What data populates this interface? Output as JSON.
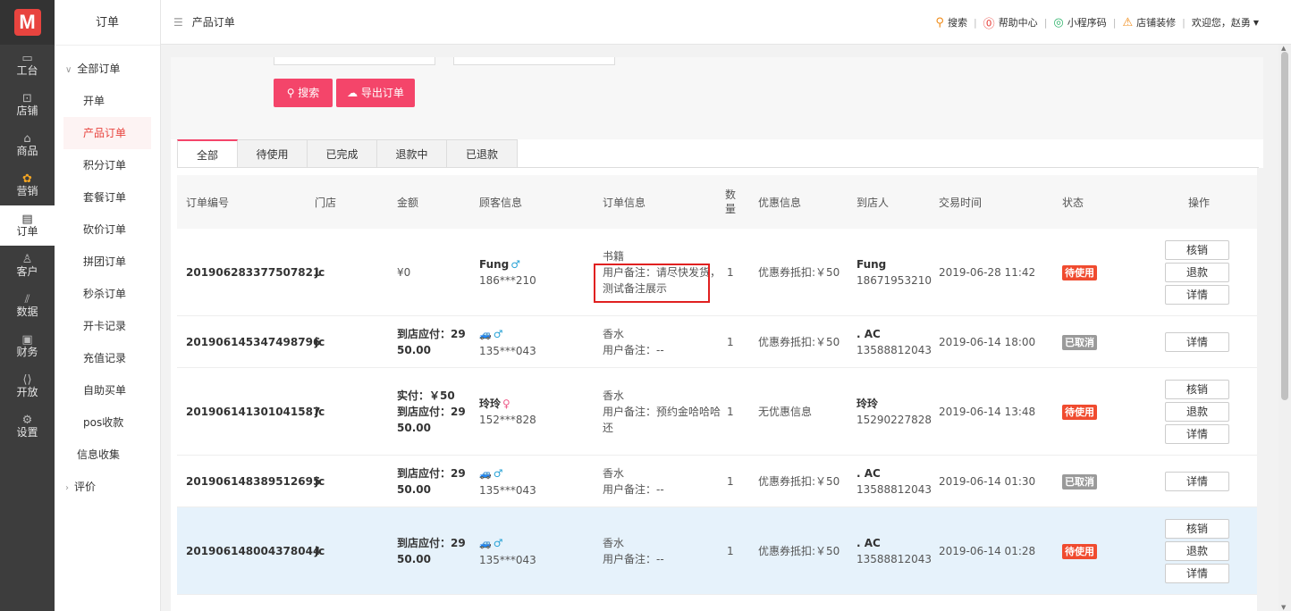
{
  "rail": {
    "logo": "M",
    "items": [
      {
        "label": "工台",
        "icon": "monitor-icon",
        "glyph": "▭"
      },
      {
        "label": "店铺",
        "icon": "store-icon",
        "glyph": "⊡"
      },
      {
        "label": "商品",
        "icon": "bag-icon",
        "glyph": "⌂"
      },
      {
        "label": "营销",
        "icon": "flower-icon",
        "glyph": "✿"
      },
      {
        "label": "订单",
        "icon": "order-icon",
        "glyph": "▤"
      },
      {
        "label": "客户",
        "icon": "user-icon",
        "glyph": "♙"
      },
      {
        "label": "数据",
        "icon": "chart-icon",
        "glyph": "⫽"
      },
      {
        "label": "财务",
        "icon": "wallet-icon",
        "glyph": "▣"
      },
      {
        "label": "开放",
        "icon": "code-icon",
        "glyph": "⟨⟩"
      },
      {
        "label": "设置",
        "icon": "gear-icon",
        "glyph": "⚙"
      }
    ]
  },
  "submenu": {
    "title": "订单",
    "group_all": "全部订单",
    "items": [
      "开单",
      "产品订单",
      "积分订单",
      "套餐订单",
      "砍价订单",
      "拼团订单",
      "秒杀订单",
      "开卡记录",
      "充值记录",
      "自助买单",
      "pos收款"
    ],
    "info": "信息收集",
    "group_review": "评价"
  },
  "header": {
    "breadcrumb": "产品订单",
    "search": "搜索",
    "help": "帮助中心",
    "miniapp": "小程序码",
    "decorate": "店铺装修",
    "welcome": "欢迎您，赵勇"
  },
  "filter": {
    "search_button": "搜索",
    "export_button": "导出订单"
  },
  "tabs": [
    "全部",
    "待使用",
    "已完成",
    "退款中",
    "已退款"
  ],
  "columns": {
    "order_no": "订单编号",
    "store": "门店",
    "amount": "金额",
    "customer": "顾客信息",
    "order_info": "订单信息",
    "qty_1": "数",
    "qty_2": "量",
    "discount": "优惠信息",
    "arrive": "到店人",
    "time": "交易时间",
    "status": "状态",
    "ops": "操作"
  },
  "rows": [
    {
      "order_no": "201906283377507821",
      "store": "jc",
      "amount_1": "¥0",
      "amount_2": "",
      "amount_3": "",
      "cust_name": "Fung",
      "cust_gender": "♂",
      "cust_phone": "186***210",
      "info_1": "书籍",
      "info_2": "用户备注：请尽快发货，",
      "info_3": "测试备注展示",
      "qty": "1",
      "discount": "优惠券抵扣:￥50",
      "arrive_name": "Fung",
      "arrive_phone": "18671953210",
      "time": "2019-06-28 11:42",
      "status": "待使用",
      "ops": [
        "核销",
        "退款",
        "详情"
      ]
    },
    {
      "order_no": "201906145347498796",
      "store": "jc",
      "amount_1": "到店应付：29",
      "amount_2": "50.00",
      "amount_3": "",
      "cust_name": "🚙",
      "cust_gender": "♂",
      "cust_phone": "135***043",
      "info_1": "香水",
      "info_2": "用户备注：--",
      "info_3": "",
      "qty": "1",
      "discount": "优惠券抵扣:￥50",
      "arrive_name": ". AC",
      "arrive_phone": "13588812043",
      "time": "2019-06-14 18:00",
      "status": "已取消",
      "ops": [
        "详情"
      ]
    },
    {
      "order_no": "201906141301041587",
      "store": "jc",
      "amount_1": "实付：￥50",
      "amount_2": "到店应付：29",
      "amount_3": "50.00",
      "cust_name": "玲玲",
      "cust_gender": "♀",
      "cust_phone": "152***828",
      "info_1": "香水",
      "info_2": "用户备注：预约金哈哈哈",
      "info_3": "还",
      "qty": "1",
      "discount": "无优惠信息",
      "arrive_name": "玲玲",
      "arrive_phone": "15290227828",
      "time": "2019-06-14 13:48",
      "status": "待使用",
      "ops": [
        "核销",
        "退款",
        "详情"
      ]
    },
    {
      "order_no": "201906148389512695",
      "store": "jc",
      "amount_1": "到店应付：29",
      "amount_2": "50.00",
      "amount_3": "",
      "cust_name": "🚙",
      "cust_gender": "♂",
      "cust_phone": "135***043",
      "info_1": "香水",
      "info_2": "用户备注：--",
      "info_3": "",
      "qty": "1",
      "discount": "优惠券抵扣:￥50",
      "arrive_name": ". AC",
      "arrive_phone": "13588812043",
      "time": "2019-06-14 01:30",
      "status": "已取消",
      "ops": [
        "详情"
      ]
    },
    {
      "order_no": "201906148004378044",
      "store": "jc",
      "amount_1": "到店应付：29",
      "amount_2": "50.00",
      "amount_3": "",
      "cust_name": "🚙",
      "cust_gender": "♂",
      "cust_phone": "135***043",
      "info_1": "香水",
      "info_2": "用户备注：--",
      "info_3": "",
      "qty": "1",
      "discount": "优惠券抵扣:￥50",
      "arrive_name": ". AC",
      "arrive_phone": "13588812043",
      "time": "2019-06-14 01:28",
      "status": "待使用",
      "ops": [
        "核销",
        "退款",
        "详情"
      ]
    }
  ],
  "colors": {
    "brand_red": "#f4456a",
    "status_pending": "#f04b2f",
    "status_cancelled": "#9a9a9a",
    "highlight_row": "#e6f2fb"
  }
}
